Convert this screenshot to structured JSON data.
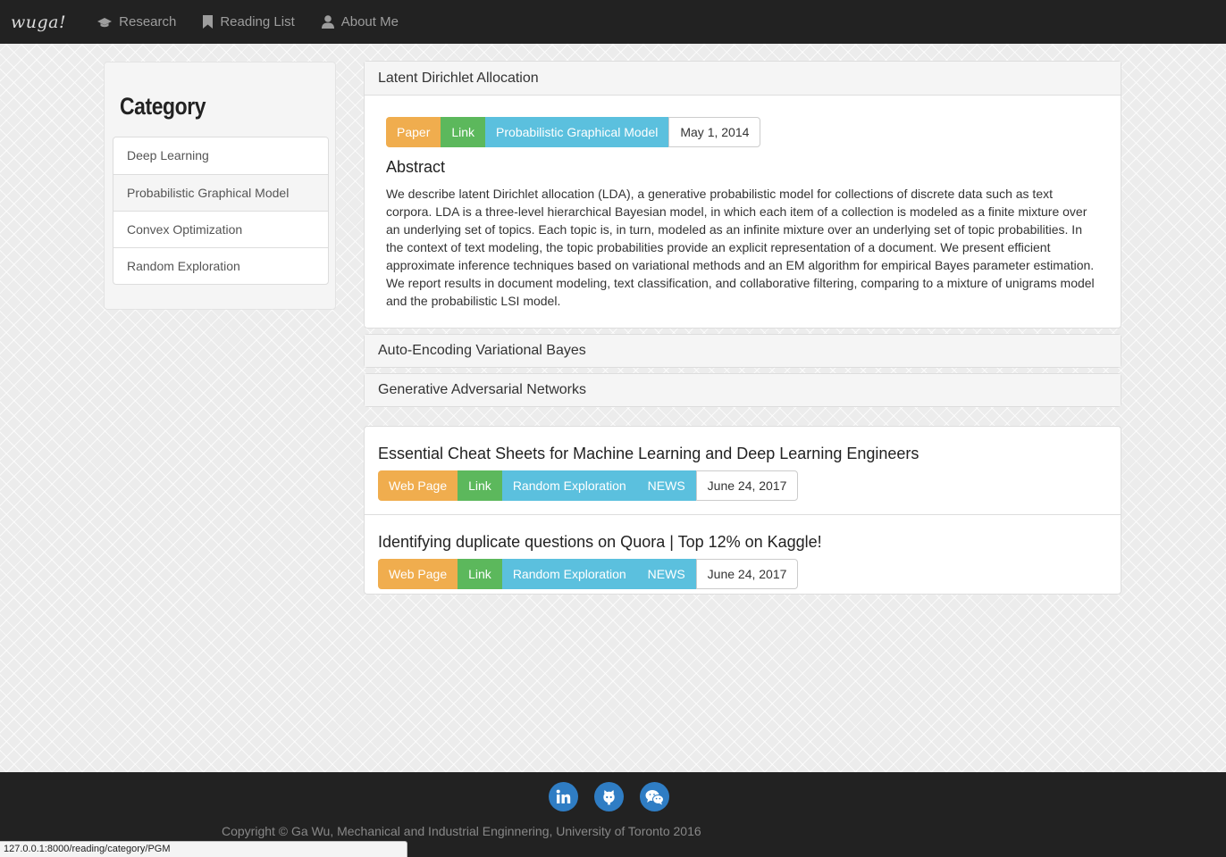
{
  "navbar": {
    "brand": "wuga!",
    "items": [
      {
        "label": "Research",
        "icon": "graduation-cap-icon"
      },
      {
        "label": "Reading List",
        "icon": "bookmark-icon"
      },
      {
        "label": "About Me",
        "icon": "user-icon"
      }
    ]
  },
  "sidebar": {
    "title": "Category",
    "items": [
      {
        "label": "Deep Learning"
      },
      {
        "label": "Probabilistic Graphical Model",
        "active": true
      },
      {
        "label": "Convex Optimization"
      },
      {
        "label": "Random Exploration"
      }
    ]
  },
  "papers": [
    {
      "title": "Latent Dirichlet Allocation",
      "expanded": true,
      "tags": {
        "type": "Paper",
        "link": "Link",
        "category": "Probabilistic Graphical Model",
        "date": "May 1, 2014"
      },
      "abstract_title": "Abstract",
      "abstract": "We describe latent Dirichlet allocation (LDA), a generative probabilistic model for collections of discrete data such as text corpora. LDA is a three-level hierarchical Bayesian model, in which each item of a collection is modeled as a finite mixture over an underlying set of topics. Each topic is, in turn, modeled as an infinite mixture over an underlying set of topic probabilities. In the context of text modeling, the topic probabilities provide an explicit representation of a document. We present efficient approximate inference techniques based on variational methods and an EM algorithm for empirical Bayes parameter estimation. We report results in document modeling, text classification, and collaborative filtering, comparing to a mixture of unigrams model and the probabilistic LSI model."
    },
    {
      "title": "Auto-Encoding Variational Bayes",
      "expanded": false
    },
    {
      "title": "Generative Adversarial Networks",
      "expanded": false
    }
  ],
  "readings": [
    {
      "title": "Essential Cheat Sheets for Machine Learning and Deep Learning Engineers",
      "tags": {
        "type": "Web Page",
        "link": "Link",
        "category": "Random Exploration",
        "extra": "NEWS",
        "date": "June 24, 2017"
      }
    },
    {
      "title": "Identifying duplicate questions on Quora | Top 12% on Kaggle!",
      "tags": {
        "type": "Web Page",
        "link": "Link",
        "category": "Random Exploration",
        "extra": "NEWS",
        "date": "June 24, 2017"
      }
    }
  ],
  "footer": {
    "social": [
      "linkedin-icon",
      "github-icon",
      "wechat-icon"
    ],
    "copyright": "Copyright © Ga Wu, Mechanical and Industrial Enginnering, University of Toronto 2016"
  },
  "statusbar": {
    "url": "127.0.0.1:8000/reading/category/PGM"
  },
  "colors": {
    "navbar": "#222222",
    "warning": "#f0ad4e",
    "success": "#5cb85c",
    "info": "#5bc0de",
    "social": "#2f7dc4"
  }
}
